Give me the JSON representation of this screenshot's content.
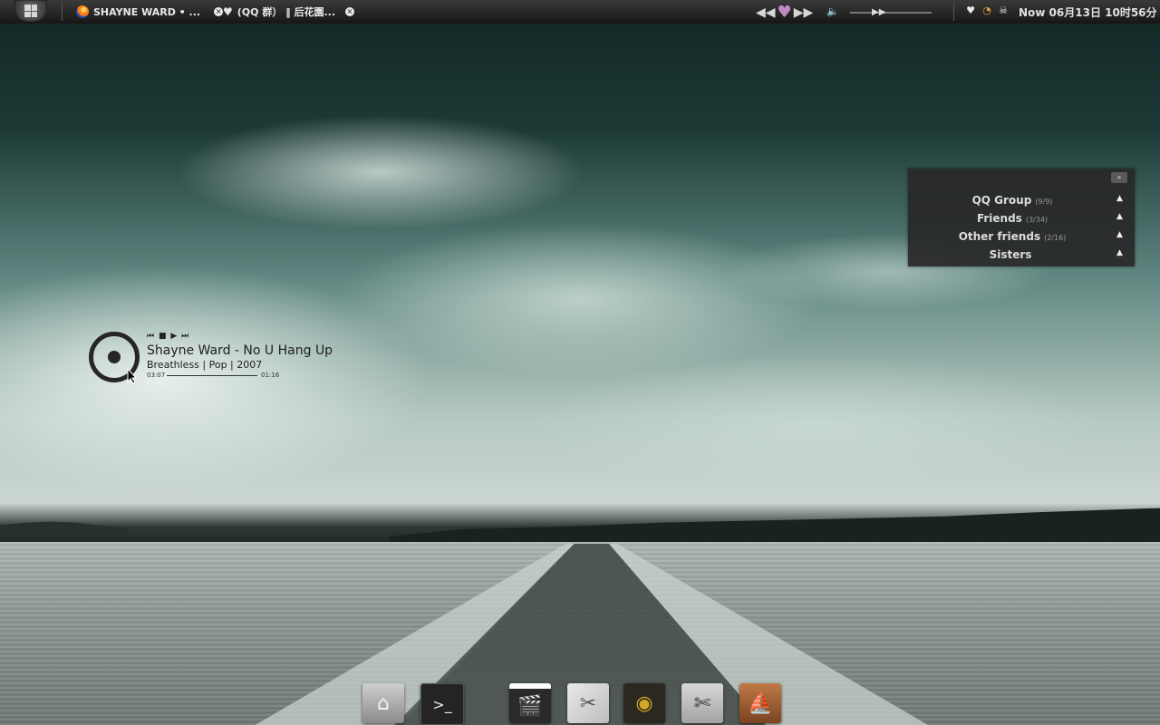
{
  "top_panel": {
    "tasks": [
      {
        "label": "SHAYNE WARD • ..."
      },
      {
        "label": "(QQ 群） ‖ 后花園..."
      }
    ],
    "clock_text": "Now 06月13日  10时56分"
  },
  "music_widget": {
    "controls": "⏮ ■ ▶ ⏭",
    "title": "Shayne Ward - No U Hang Up",
    "album_info": "Breathless | Pop | 2007",
    "elapsed": "03:07",
    "remaining": "01:16"
  },
  "qq_panel": {
    "close_label": "»",
    "groups": [
      {
        "name": "QQ Group",
        "count": "(9/9)"
      },
      {
        "name": "Friends",
        "count": "(3/34)"
      },
      {
        "name": "Other friends",
        "count": "(2/16)"
      },
      {
        "name": "Sisters",
        "count": ""
      }
    ]
  },
  "dock": {
    "items": [
      "home-icon",
      "terminal-icon",
      "video-editor-icon",
      "settings-icon",
      "radar-icon",
      "cut-tool-icon",
      "pirate-bay-icon"
    ]
  },
  "colors": {
    "panel_bg": "#1a1a1a",
    "heart_accent": "#c28bc6"
  }
}
